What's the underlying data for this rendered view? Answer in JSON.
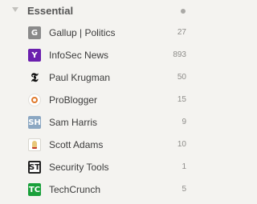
{
  "section": {
    "title": "Essential"
  },
  "feeds": [
    {
      "name": "Gallup | Politics",
      "count": "27",
      "icon": "gallup-icon",
      "glyph": "G"
    },
    {
      "name": "InfoSec News",
      "count": "893",
      "icon": "yahoo-icon",
      "glyph": "Y"
    },
    {
      "name": "Paul Krugman",
      "count": "50",
      "icon": "nyt-icon",
      "glyph": "𝕿"
    },
    {
      "name": "ProBlogger",
      "count": "15",
      "icon": "problogger-icon",
      "glyph": ""
    },
    {
      "name": "Sam Harris",
      "count": "9",
      "icon": "sam-harris-icon",
      "glyph": "SH"
    },
    {
      "name": "Scott Adams",
      "count": "10",
      "icon": "dilbert-icon",
      "glyph": ""
    },
    {
      "name": "Security Tools",
      "count": "1",
      "icon": "security-tools-icon",
      "glyph": "ST"
    },
    {
      "name": "TechCrunch",
      "count": "5",
      "icon": "techcrunch-icon",
      "glyph": "TC"
    }
  ],
  "colors": {
    "background": "#f4f3f0",
    "text": "#3b3b3b",
    "count": "#8d8c89",
    "yahoo": "#6b1fae",
    "techcrunch": "#1aa03b",
    "sam_harris": "#8ba7c2",
    "gallup": "#8a8a8a"
  }
}
